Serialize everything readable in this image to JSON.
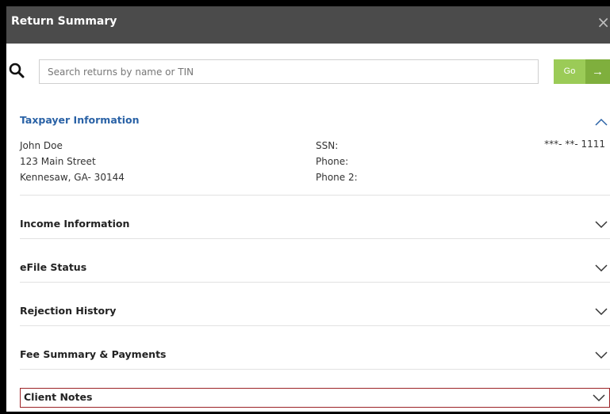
{
  "window": {
    "title": "Return Summary",
    "close_glyph": "×"
  },
  "search": {
    "placeholder": "Search returns by name or TIN",
    "value": "",
    "go_label": "Go",
    "go_arrow": "→"
  },
  "taxpayer": {
    "title": "Taxpayer Information",
    "name": "John Doe",
    "street": "123 Main Street",
    "city_state_zip": "Kennesaw, GA- 30144",
    "ssn_label": "SSN:",
    "ssn_value": "***- **- 1111",
    "phone_label": "Phone:",
    "phone_value": "",
    "phone2_label": "Phone 2:",
    "phone2_value": ""
  },
  "sections": [
    {
      "title": "Income Information"
    },
    {
      "title": "eFile Status"
    },
    {
      "title": "Rejection History"
    },
    {
      "title": "Fee Summary & Payments"
    },
    {
      "title": "Client Notes"
    }
  ],
  "colors": {
    "titlebar": "#4b4b4b",
    "link_blue": "#2a62a6",
    "go_green": "#9bcb57",
    "highlight_red": "#9b2226"
  },
  "icons": {
    "search": "search-icon",
    "close": "close-icon",
    "expanded": "chevron-up-icon",
    "collapsed": "chevron-down-icon"
  }
}
